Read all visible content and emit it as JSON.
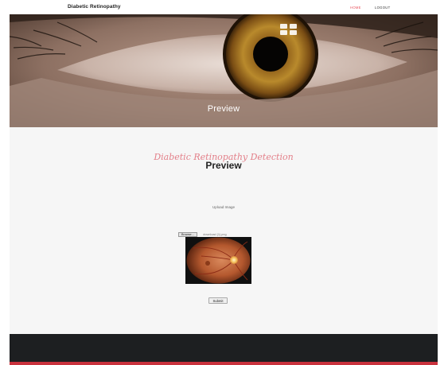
{
  "navbar": {
    "brand": "Diabetic Retinopathy",
    "links": [
      "HOME",
      "LOGOUT"
    ],
    "active_color": "#e8505b"
  },
  "hero": {
    "title": "Preview",
    "image": "close-up-human-eye-photo"
  },
  "main": {
    "script_title": "Diabetic Retinopathy Detection",
    "heading": "Preview",
    "upload_label": "Upload Image",
    "browse_label": "Browse...",
    "file_name": "download (1).png",
    "preview_image": "retinal-fundus-photo",
    "submit_label": "Submit"
  },
  "footer": {
    "accent_color": "#c9323d",
    "background_color": "#1d1f21"
  }
}
